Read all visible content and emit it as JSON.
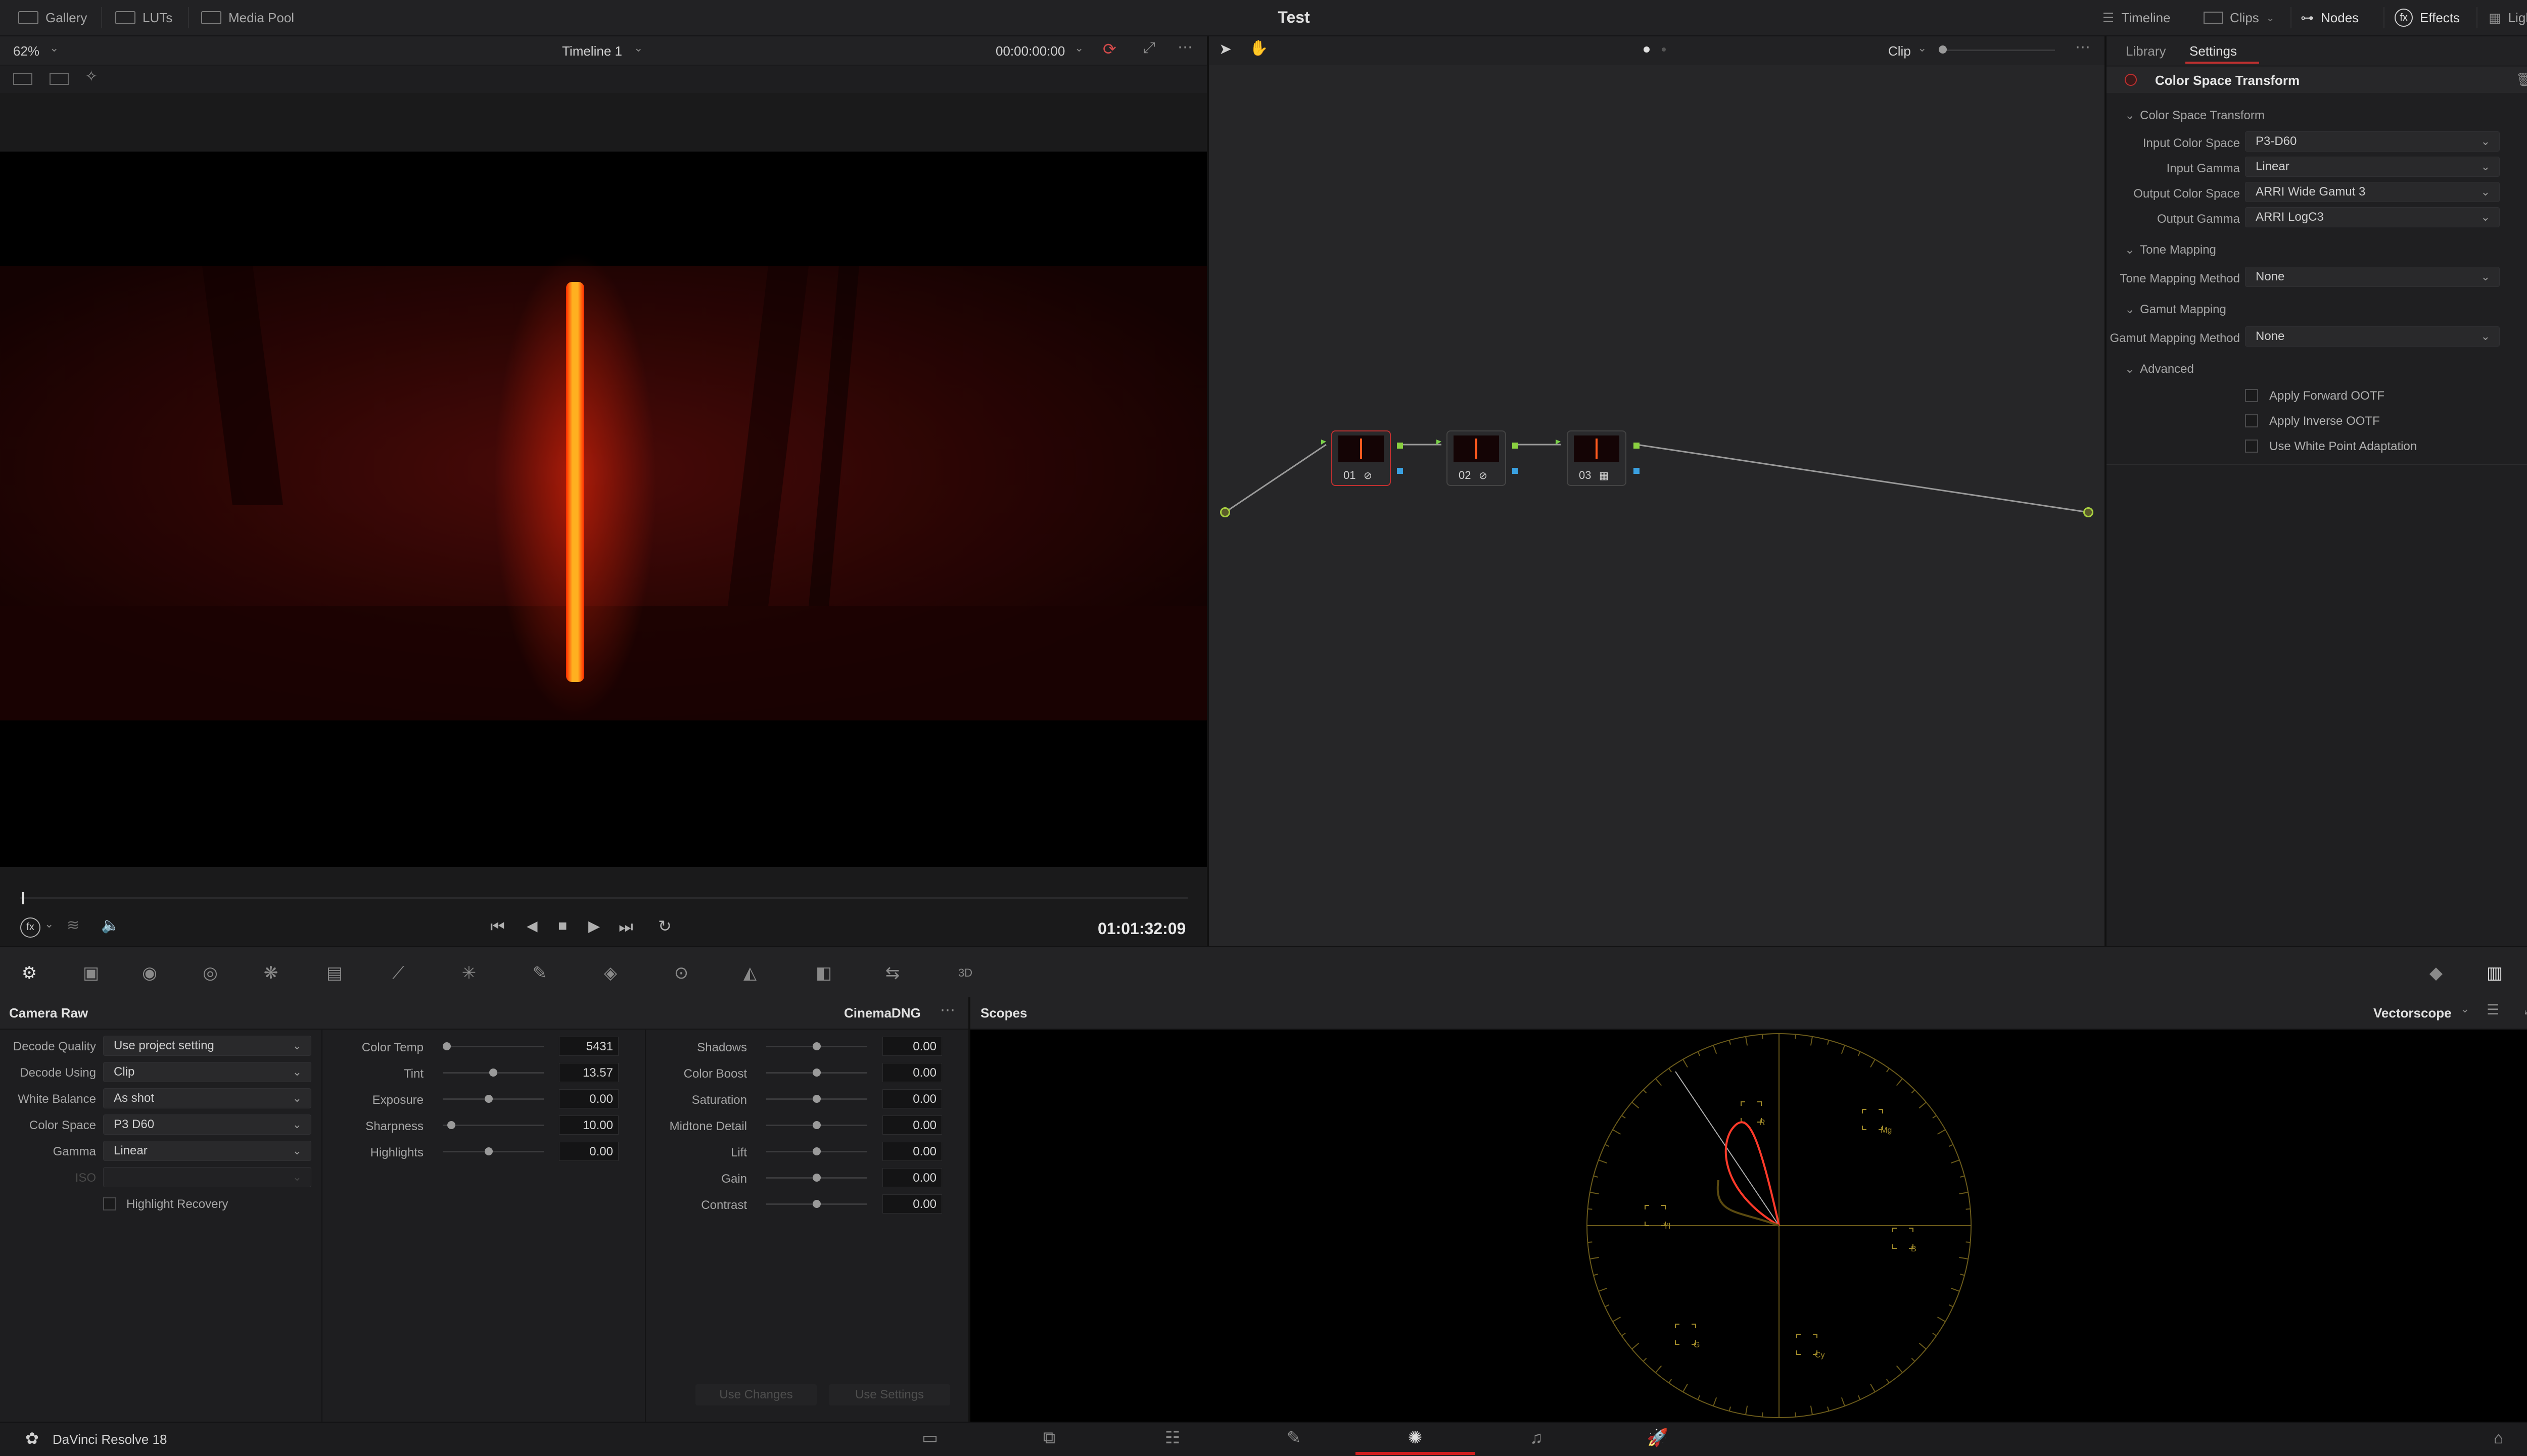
{
  "header": {
    "title": "Test",
    "left_buttons": [
      "Gallery",
      "LUTs",
      "Media Pool"
    ],
    "right_buttons": [
      "Timeline",
      "Clips",
      "Nodes",
      "Effects",
      "Lightbox"
    ]
  },
  "viewer": {
    "zoom": "62%",
    "timeline_name": "Timeline 1",
    "timecode": "00:00:00:00",
    "playhead_timecode": "01:01:32:09"
  },
  "node_editor": {
    "mode": "Clip",
    "nodes": [
      {
        "label": "01"
      },
      {
        "label": "02"
      },
      {
        "label": "03"
      }
    ]
  },
  "inspector": {
    "tabs": [
      "Library",
      "Settings"
    ],
    "active_tab": "Settings",
    "effect_title": "Color Space Transform",
    "sections": {
      "cst": "Color Space Transform",
      "tone": "Tone Mapping",
      "gamut": "Gamut Mapping",
      "advanced": "Advanced"
    },
    "fields": {
      "input_color_space": {
        "label": "Input Color Space",
        "value": "P3-D60"
      },
      "input_gamma": {
        "label": "Input Gamma",
        "value": "Linear"
      },
      "output_color_space": {
        "label": "Output Color Space",
        "value": "ARRI Wide Gamut 3"
      },
      "output_gamma": {
        "label": "Output Gamma",
        "value": "ARRI LogC3"
      },
      "tone_mapping_method": {
        "label": "Tone Mapping Method",
        "value": "None"
      },
      "gamut_mapping_method": {
        "label": "Gamut Mapping Method",
        "value": "None"
      }
    },
    "checkboxes": [
      {
        "label": "Apply Forward OOTF",
        "checked": false
      },
      {
        "label": "Apply Inverse OOTF",
        "checked": false
      },
      {
        "label": "Use White Point Adaptation",
        "checked": false
      }
    ]
  },
  "camera_raw": {
    "title": "Camera Raw",
    "format": "CinemaDNG",
    "decode": [
      {
        "label": "Decode Quality",
        "value": "Use project setting"
      },
      {
        "label": "Decode Using",
        "value": "Clip"
      },
      {
        "label": "White Balance",
        "value": "As shot"
      },
      {
        "label": "Color Space",
        "value": "P3 D60"
      },
      {
        "label": "Gamma",
        "value": "Linear"
      },
      {
        "label": "ISO",
        "value": ""
      }
    ],
    "highlight_recovery": "Highlight Recovery",
    "sliders_a": [
      {
        "label": "Color Temp",
        "value": "5431",
        "pos": 0.0
      },
      {
        "label": "Tint",
        "value": "13.57",
        "pos": 0.5
      },
      {
        "label": "Exposure",
        "value": "0.00",
        "pos": 0.45
      },
      {
        "label": "Sharpness",
        "value": "10.00",
        "pos": 0.05
      },
      {
        "label": "Highlights",
        "value": "0.00",
        "pos": 0.45
      }
    ],
    "sliders_b": [
      {
        "label": "Shadows",
        "value": "0.00",
        "pos": 0.5
      },
      {
        "label": "Color Boost",
        "value": "0.00",
        "pos": 0.5
      },
      {
        "label": "Saturation",
        "value": "0.00",
        "pos": 0.5
      },
      {
        "label": "Midtone Detail",
        "value": "0.00",
        "pos": 0.5
      },
      {
        "label": "Lift",
        "value": "0.00",
        "pos": 0.5
      },
      {
        "label": "Gain",
        "value": "0.00",
        "pos": 0.5
      },
      {
        "label": "Contrast",
        "value": "0.00",
        "pos": 0.5
      }
    ],
    "use_changes": "Use Changes",
    "use_settings": "Use Settings"
  },
  "scopes": {
    "title": "Scopes",
    "mode": "Vectorscope",
    "targets": [
      "R",
      "Mg",
      "B",
      "Cy",
      "G",
      "Yl"
    ]
  },
  "footer": {
    "app_name": "DaVinci Resolve 18"
  }
}
